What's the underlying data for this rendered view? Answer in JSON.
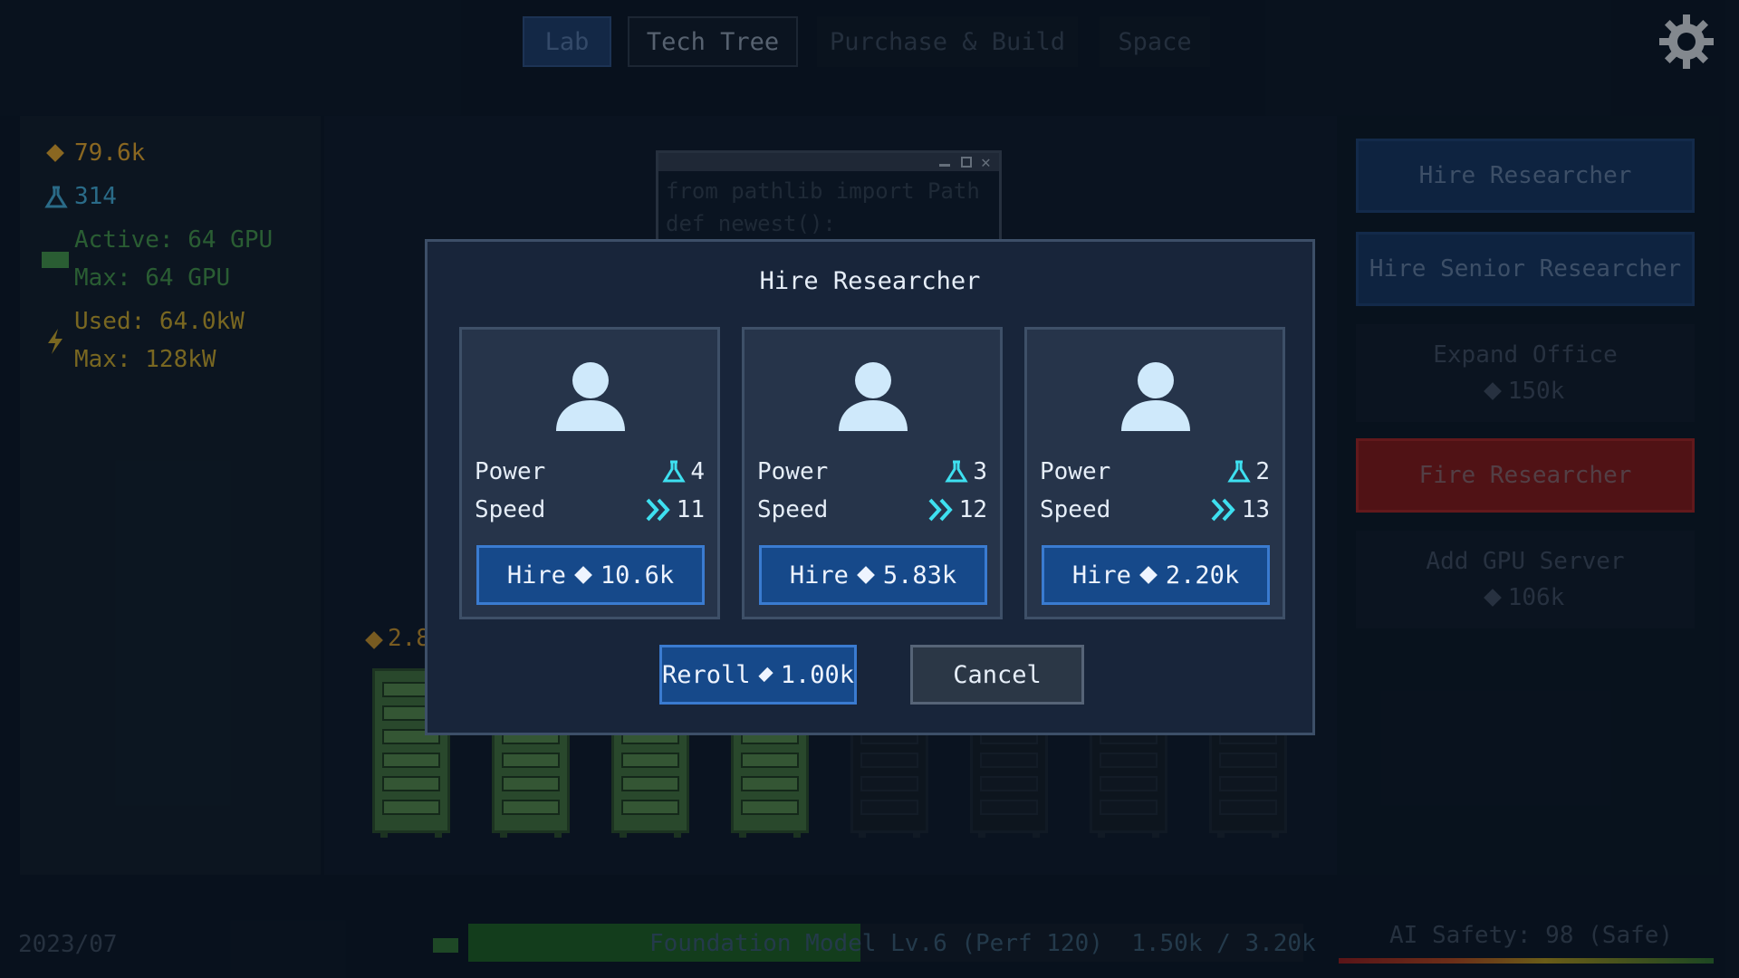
{
  "nav": {
    "tabs": [
      {
        "label": "Lab",
        "state": "active"
      },
      {
        "label": "Tech Tree",
        "state": "normal"
      },
      {
        "label": "Purchase & Build",
        "state": "dim"
      },
      {
        "label": "Space",
        "state": "dim"
      }
    ],
    "settings_icon": "gear-icon"
  },
  "stats": {
    "money": "79.6k",
    "research": "314",
    "gpu_active": "Active: 64 GPU",
    "gpu_max": "Max: 64 GPU",
    "power_used": "Used: 64.0kW",
    "power_max": "Max: 128kW"
  },
  "code_window": {
    "line1": "from pathlib import Path",
    "line2": "def newest():"
  },
  "server_cost": "2.8",
  "racks": {
    "active": 4,
    "total": 8
  },
  "actions": {
    "hire_researcher": "Hire Researcher",
    "hire_senior": "Hire Senior Researcher",
    "expand_office": "Expand Office",
    "expand_office_cost": "150k",
    "fire_researcher": "Fire Researcher",
    "add_gpu_server": "Add GPU Server",
    "add_gpu_server_cost": "106k"
  },
  "modal": {
    "title": "Hire Researcher",
    "power_label": "Power",
    "speed_label": "Speed",
    "hire_label": "Hire",
    "candidates": [
      {
        "power": "4",
        "speed": "11",
        "cost": "10.6k"
      },
      {
        "power": "3",
        "speed": "12",
        "cost": "5.83k"
      },
      {
        "power": "2",
        "speed": "13",
        "cost": "2.20k"
      }
    ],
    "reroll_label": "Reroll",
    "reroll_cost": "1.00k",
    "cancel_label": "Cancel"
  },
  "bottom": {
    "date": "2023/07",
    "model_text": "Foundation Model Lv.6 (Perf 120)",
    "model_progress_text": "1.50k / 3.20k",
    "model_progress": 0.47,
    "safety_text": "AI Safety: 98 (Safe)",
    "safety_level": 0.98
  },
  "colors": {
    "money": "#d39a2a",
    "research": "#3fa0c8",
    "gpu": "#3f8b45",
    "power": "#b89a2a",
    "accent_blue": "#16498a",
    "fire_red": "#b71c1c",
    "cyan_icon": "#3ee0f0"
  }
}
